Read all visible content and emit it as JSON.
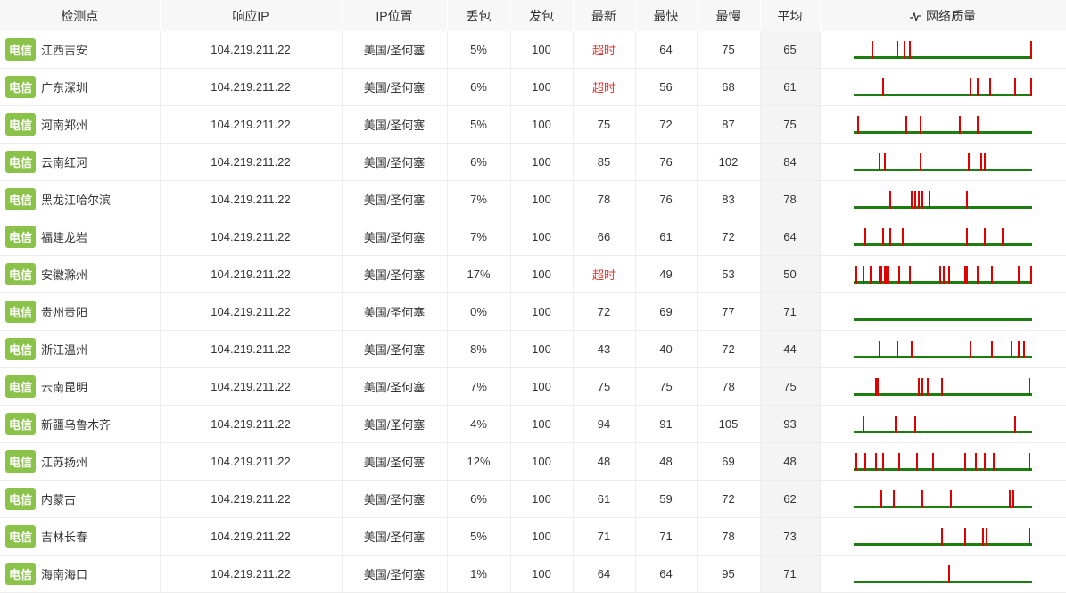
{
  "headers": {
    "node": "检测点",
    "ip": "响应IP",
    "location": "IP位置",
    "loss": "丢包",
    "sent": "发包",
    "latest": "最新",
    "fastest": "最快",
    "slowest": "最慢",
    "avg": "平均",
    "quality": "网络质量",
    "quality_icon": "pulse-icon"
  },
  "colors": {
    "isp_badge": "#8bc34a",
    "timeout": "#e53935",
    "good_bar": "#1e7d10",
    "loss_spike": "#e00000"
  },
  "rows": [
    {
      "isp": "电信",
      "node": "江西吉安",
      "ip": "104.219.211.22",
      "location": "美国/圣何塞",
      "loss": "5%",
      "sent": "100",
      "latest": "超时",
      "latest_timeout": true,
      "fastest": "64",
      "slowest": "75",
      "avg": "65",
      "spikes": [
        10,
        24,
        28,
        31,
        99
      ]
    },
    {
      "isp": "电信",
      "node": "广东深圳",
      "ip": "104.219.211.22",
      "location": "美国/圣何塞",
      "loss": "6%",
      "sent": "100",
      "latest": "超时",
      "latest_timeout": true,
      "fastest": "56",
      "slowest": "68",
      "avg": "61",
      "spikes": [
        16,
        65,
        69,
        76,
        90,
        99
      ]
    },
    {
      "isp": "电信",
      "node": "河南郑州",
      "ip": "104.219.211.22",
      "location": "美国/圣何塞",
      "loss": "5%",
      "sent": "100",
      "latest": "75",
      "latest_timeout": false,
      "fastest": "72",
      "slowest": "87",
      "avg": "75",
      "spikes": [
        2,
        29,
        37,
        59,
        69
      ]
    },
    {
      "isp": "电信",
      "node": "云南红河",
      "ip": "104.219.211.22",
      "location": "美国/圣何塞",
      "loss": "6%",
      "sent": "100",
      "latest": "85",
      "latest_timeout": false,
      "fastest": "76",
      "slowest": "102",
      "avg": "84",
      "spikes": [
        14,
        17,
        37,
        64,
        71,
        73
      ]
    },
    {
      "isp": "电信",
      "node": "黑龙江哈尔滨",
      "ip": "104.219.211.22",
      "location": "美国/圣何塞",
      "loss": "7%",
      "sent": "100",
      "latest": "78",
      "latest_timeout": false,
      "fastest": "76",
      "slowest": "83",
      "avg": "78",
      "spikes": [
        20,
        32,
        34,
        36,
        38,
        42,
        63
      ]
    },
    {
      "isp": "电信",
      "node": "福建龙岩",
      "ip": "104.219.211.22",
      "location": "美国/圣何塞",
      "loss": "7%",
      "sent": "100",
      "latest": "66",
      "latest_timeout": false,
      "fastest": "61",
      "slowest": "72",
      "avg": "64",
      "spikes": [
        6,
        16,
        20,
        27,
        63,
        73,
        83
      ]
    },
    {
      "isp": "电信",
      "node": "安徽滁州",
      "ip": "104.219.211.22",
      "location": "美国/圣何塞",
      "loss": "17%",
      "sent": "100",
      "latest": "超时",
      "latest_timeout": true,
      "fastest": "49",
      "slowest": "53",
      "avg": "50",
      "spikes": [
        1,
        5,
        9,
        14,
        15,
        17,
        18,
        19,
        25,
        31,
        48,
        50,
        53,
        62,
        63,
        69,
        77,
        92,
        99
      ]
    },
    {
      "isp": "电信",
      "node": "贵州贵阳",
      "ip": "104.219.211.22",
      "location": "美国/圣何塞",
      "loss": "0%",
      "sent": "100",
      "latest": "72",
      "latest_timeout": false,
      "fastest": "69",
      "slowest": "77",
      "avg": "71",
      "spikes": []
    },
    {
      "isp": "电信",
      "node": "浙江温州",
      "ip": "104.219.211.22",
      "location": "美国/圣何塞",
      "loss": "8%",
      "sent": "100",
      "latest": "43",
      "latest_timeout": false,
      "fastest": "40",
      "slowest": "72",
      "avg": "44",
      "spikes": [
        14,
        24,
        32,
        65,
        77,
        88,
        92,
        95
      ]
    },
    {
      "isp": "电信",
      "node": "云南昆明",
      "ip": "104.219.211.22",
      "location": "美国/圣何塞",
      "loss": "7%",
      "sent": "100",
      "latest": "75",
      "latest_timeout": false,
      "fastest": "75",
      "slowest": "78",
      "avg": "75",
      "spikes": [
        12,
        13,
        36,
        38,
        41,
        49,
        98
      ]
    },
    {
      "isp": "电信",
      "node": "新疆乌鲁木齐",
      "ip": "104.219.211.22",
      "location": "美国/圣何塞",
      "loss": "4%",
      "sent": "100",
      "latest": "94",
      "latest_timeout": false,
      "fastest": "91",
      "slowest": "105",
      "avg": "93",
      "spikes": [
        5,
        23,
        34,
        90
      ]
    },
    {
      "isp": "电信",
      "node": "江苏扬州",
      "ip": "104.219.211.22",
      "location": "美国/圣何塞",
      "loss": "12%",
      "sent": "100",
      "latest": "48",
      "latest_timeout": false,
      "fastest": "48",
      "slowest": "69",
      "avg": "48",
      "spikes": [
        1,
        6,
        12,
        16,
        25,
        35,
        44,
        62,
        68,
        73,
        78,
        98
      ]
    },
    {
      "isp": "电信",
      "node": "内蒙古",
      "ip": "104.219.211.22",
      "location": "美国/圣何塞",
      "loss": "6%",
      "sent": "100",
      "latest": "61",
      "latest_timeout": false,
      "fastest": "59",
      "slowest": "72",
      "avg": "62",
      "spikes": [
        15,
        22,
        38,
        54,
        87,
        89
      ]
    },
    {
      "isp": "电信",
      "node": "吉林长春",
      "ip": "104.219.211.22",
      "location": "美国/圣何塞",
      "loss": "5%",
      "sent": "100",
      "latest": "71",
      "latest_timeout": false,
      "fastest": "71",
      "slowest": "78",
      "avg": "73",
      "spikes": [
        49,
        62,
        72,
        74,
        98
      ]
    },
    {
      "isp": "电信",
      "node": "海南海口",
      "ip": "104.219.211.22",
      "location": "美国/圣何塞",
      "loss": "1%",
      "sent": "100",
      "latest": "64",
      "latest_timeout": false,
      "fastest": "64",
      "slowest": "95",
      "avg": "71",
      "spikes": [
        53
      ]
    }
  ]
}
